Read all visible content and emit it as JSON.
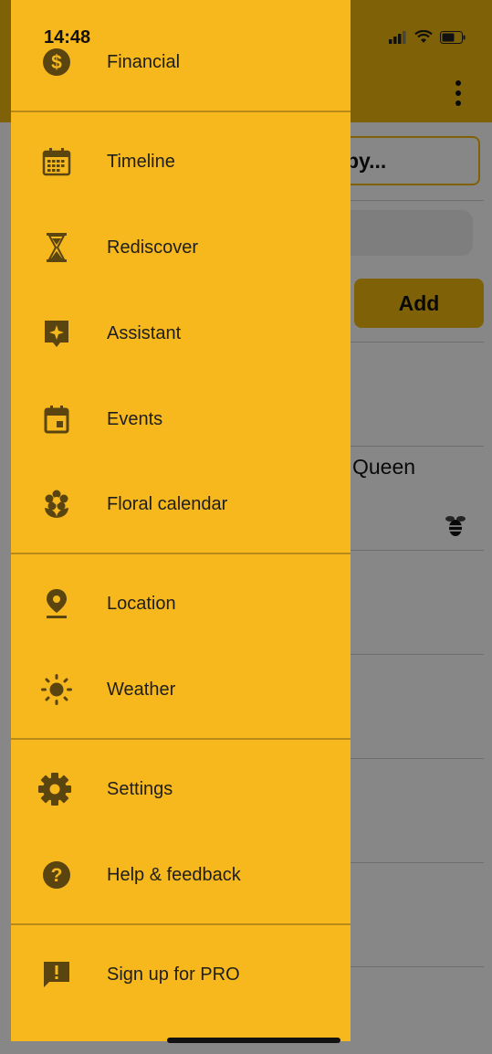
{
  "status_bar": {
    "time": "14:48"
  },
  "background": {
    "sort_label": "rt by...",
    "add_label": "Add",
    "list_text": "Queen"
  },
  "drawer": {
    "items": [
      {
        "label": "Financial",
        "icon": "dollar-icon"
      },
      {
        "label": "Timeline",
        "icon": "calendar-grid-icon"
      },
      {
        "label": "Rediscover",
        "icon": "hourglass-icon"
      },
      {
        "label": "Assistant",
        "icon": "sparkle-chat-icon"
      },
      {
        "label": "Events",
        "icon": "event-calendar-icon"
      },
      {
        "label": "Floral calendar",
        "icon": "flower-icon"
      },
      {
        "label": "Location",
        "icon": "location-pin-icon"
      },
      {
        "label": "Weather",
        "icon": "sun-icon"
      },
      {
        "label": "Settings",
        "icon": "gear-icon"
      },
      {
        "label": "Help & feedback",
        "icon": "help-icon"
      },
      {
        "label": "Sign up for PRO",
        "icon": "alert-message-icon"
      }
    ]
  },
  "colors": {
    "drawer_bg": "#f6b81d",
    "icon_color": "#5a4410",
    "scrim": "rgba(0,0,0,0.47)",
    "header_bg": "#f0b90f"
  }
}
